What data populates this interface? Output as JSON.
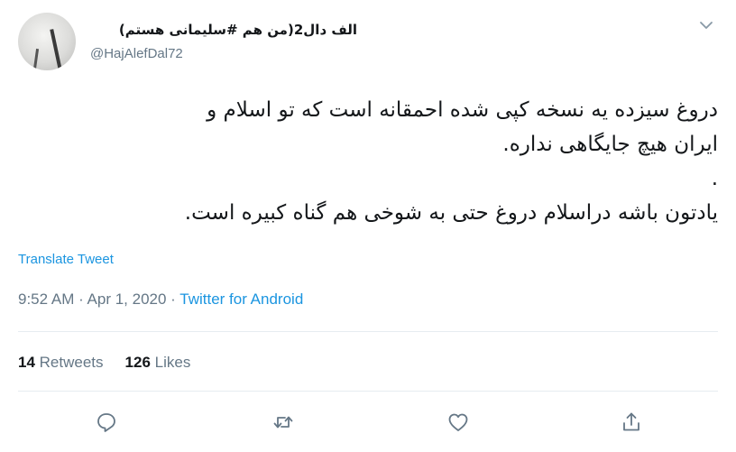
{
  "user": {
    "display_name": "الف دال2(من هم #سلیمانی هستم)",
    "handle": "@HajAlefDal72"
  },
  "tweet": {
    "lines": [
      "دروغ سیزده یه نسخه کپی شده احمقانه است که تو اسلام و",
      "ایران هیچ جایگاهی نداره.",
      ".",
      "یادتون باشه دراسلام دروغ حتی به شوخی هم گناه کبیره است."
    ],
    "translate_label": "Translate Tweet",
    "time": "9:52 AM",
    "date": "Apr 1, 2020",
    "separator": " · ",
    "source": "Twitter for Android"
  },
  "stats": {
    "retweets_count": "14",
    "retweets_label": "Retweets",
    "likes_count": "126",
    "likes_label": "Likes"
  },
  "icons": {
    "caret": "chevron-down-icon",
    "reply": "reply-icon",
    "retweet": "retweet-icon",
    "like": "heart-icon",
    "share": "share-icon"
  },
  "colors": {
    "link": "#1b95e0",
    "muted": "#657786",
    "text": "#14171a",
    "divider": "#e6ecf0"
  }
}
